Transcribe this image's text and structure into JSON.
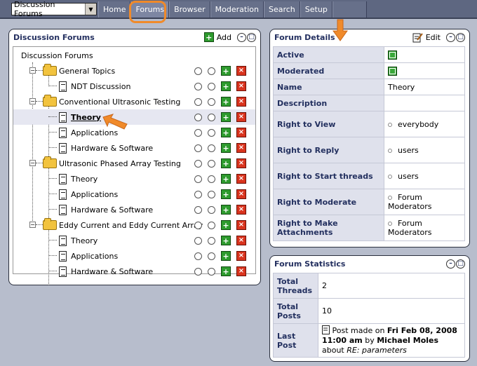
{
  "topbar": {
    "selector_value": "Discussion Forums",
    "tabs": [
      "Home",
      "Forums",
      "Browser",
      "Moderation",
      "Search",
      "Setup",
      ""
    ],
    "active_tab": "Forums"
  },
  "forums_panel": {
    "title": "Discussion Forums",
    "add_label": "Add",
    "root": "Discussion Forums",
    "groups": [
      {
        "label": "General Topics",
        "forums": [
          "NDT Discussion"
        ]
      },
      {
        "label": "Conventional Ultrasonic Testing",
        "forums": [
          "Theory",
          "Applications",
          "Hardware & Software"
        ]
      },
      {
        "label": "Ultrasonic Phased Array Testing",
        "forums": [
          "Theory",
          "Applications",
          "Hardware & Software"
        ]
      },
      {
        "label": "Eddy Current and Eddy Current Array",
        "forums": [
          "Theory",
          "Applications",
          "Hardware & Software"
        ]
      }
    ],
    "selected_forum": "Theory"
  },
  "details_panel": {
    "title": "Forum Details",
    "edit_label": "Edit",
    "rows": [
      {
        "key": "Active",
        "value": ""
      },
      {
        "key": "Moderated",
        "value": ""
      },
      {
        "key": "Name",
        "value": "Theory"
      },
      {
        "key": "Description",
        "value": ""
      },
      {
        "key": "Right to View",
        "value": "everybody"
      },
      {
        "key": "Right to Reply",
        "value": "users"
      },
      {
        "key": "Right to Start threads",
        "value": "users"
      },
      {
        "key": "Right to Moderate",
        "value": "Forum Moderators"
      },
      {
        "key": "Right to Make Attachments",
        "value": "Forum Moderators"
      }
    ]
  },
  "stats_panel": {
    "title": "Forum Statistics",
    "total_threads_label1": "Total",
    "total_threads_label2": "Threads",
    "total_threads": "2",
    "total_posts_label1": "Total",
    "total_posts_label2": "Posts",
    "total_posts": "10",
    "last_post_label": "Last Post",
    "last_post_prefix": "Post made on",
    "last_post_date": "Fri Feb 08, 2008 11:00 am",
    "last_post_by": "by",
    "last_post_author": "Michael Moles",
    "last_post_about": "about",
    "last_post_topic": "RE: parameters"
  },
  "colors": {
    "accent_orange": "#f08a2a",
    "topbar": "#5e6781",
    "background": "#b7bdcc"
  }
}
